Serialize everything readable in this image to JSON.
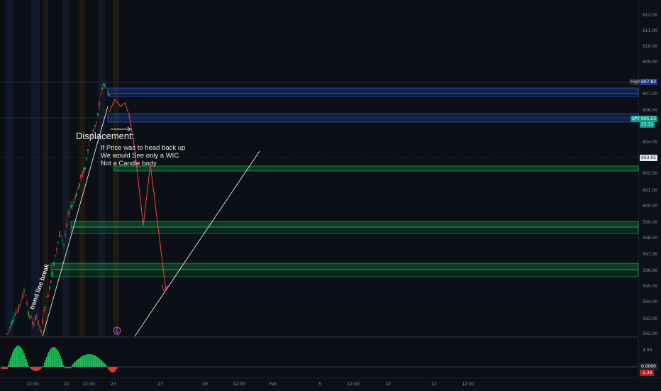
{
  "price_axis": {
    "ticks": [
      "612.00",
      "611.00",
      "610.00",
      "609.00",
      "607.00",
      "606.00",
      "604.00",
      "603.00",
      "602.00",
      "601.00",
      "600.00",
      "599.00",
      "598.00",
      "597.00",
      "596.00",
      "595.00",
      "594.00",
      "593.00",
      "592.00"
    ],
    "high_label": "High",
    "high_value": "607.83",
    "symbol_label": "SPY",
    "last_price": "605.53",
    "countdown": "25:31",
    "line_price": "603.05"
  },
  "osc_axis": {
    "top_value": "4.00",
    "zero_value": "0.0000",
    "neg_value": "-1.36"
  },
  "time_axis": {
    "ticks": [
      "12:00",
      "21",
      "12:00",
      "23",
      "27",
      "29",
      "12:00",
      "Feb",
      "5",
      "12:00",
      "10",
      "12",
      "12:00"
    ]
  },
  "annotations": {
    "displacement": "Displacement:",
    "note_line1": "If Price was to head back up",
    "note_line2": "We would See only a WIC",
    "note_line3": "Not a Candle body",
    "trend_break": "trend line break"
  },
  "colors": {
    "up": "#22c55e",
    "down": "#ef4444",
    "blue_zone": "#2962ff",
    "green_zone": "#16a34a",
    "projection": "#ef4444",
    "high_tag": "#1e3a8a",
    "symbol_tag": "#0f9d8a"
  },
  "icons": {
    "event_marker": "lightning-icon"
  }
}
